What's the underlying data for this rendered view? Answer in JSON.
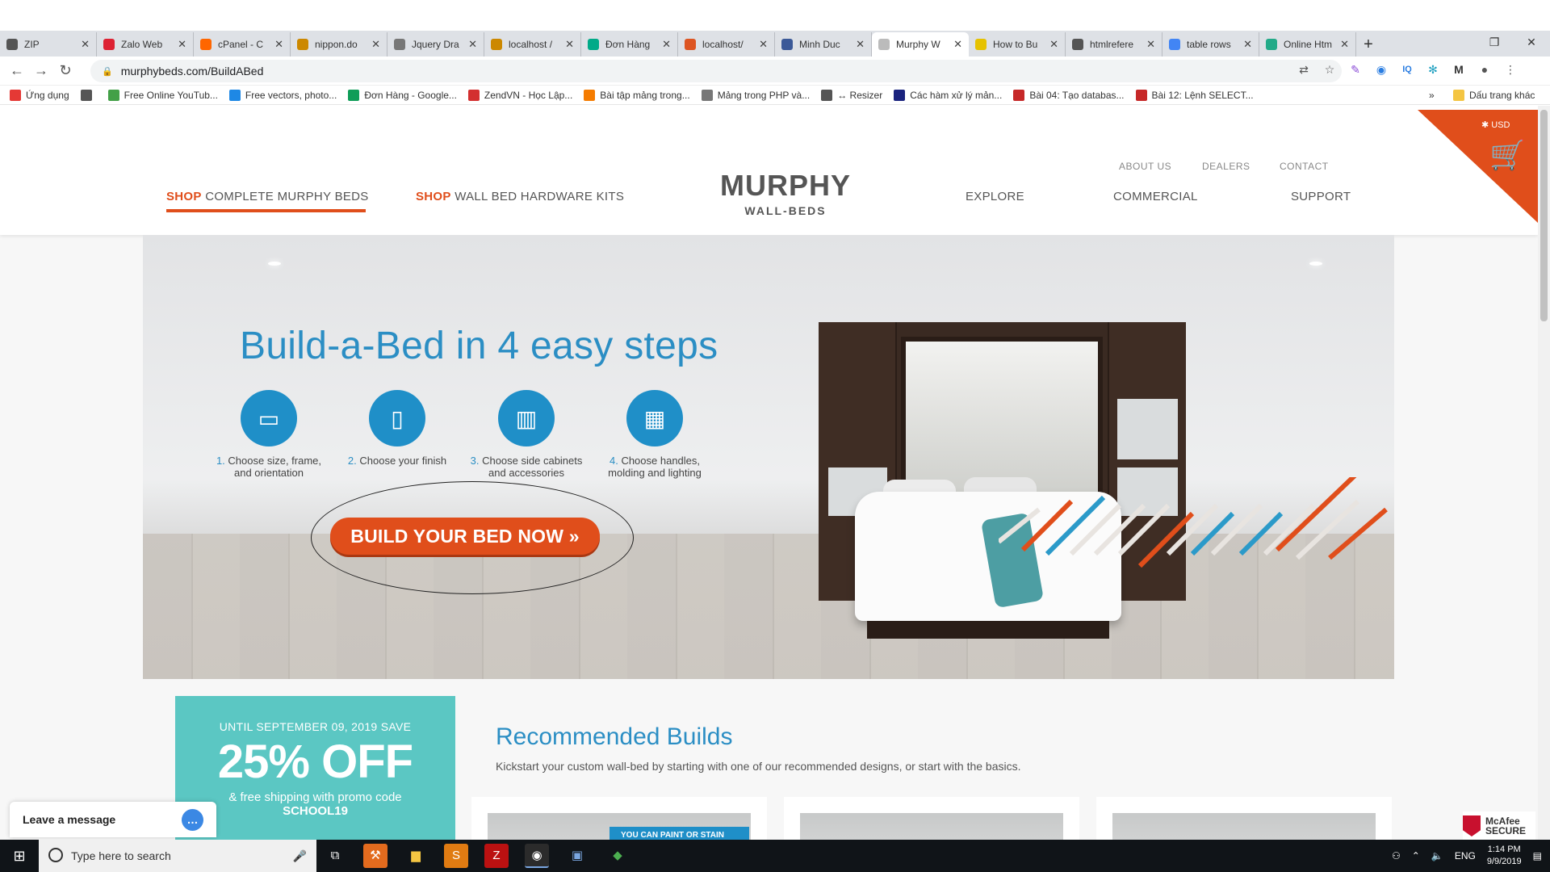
{
  "browser": {
    "tabs": [
      {
        "title": "ZIP",
        "color": "#555"
      },
      {
        "title": "Zalo Web",
        "color": "#d23"
      },
      {
        "title": "cPanel - C",
        "color": "#f60"
      },
      {
        "title": "nippon.do",
        "color": "#c80"
      },
      {
        "title": "Jquery Dra",
        "color": "#777"
      },
      {
        "title": "localhost /",
        "color": "#c80"
      },
      {
        "title": "Đơn Hàng",
        "color": "#0a8"
      },
      {
        "title": "localhost/",
        "color": "#d52"
      },
      {
        "title": "Minh Duc",
        "color": "#3b5998"
      },
      {
        "title": "Murphy W",
        "color": "#bbb"
      },
      {
        "title": "How to Bu",
        "color": "#e6c200"
      },
      {
        "title": "htmlrefere",
        "color": "#555"
      },
      {
        "title": "table rows",
        "color": "#4285f4"
      },
      {
        "title": "Online Htm",
        "color": "#2a8"
      }
    ],
    "url": "murphybeds.com/BuildABed",
    "bookmarks": [
      {
        "label": "Ứng dụng"
      },
      {
        "label": ""
      },
      {
        "label": "Free Online YouTub..."
      },
      {
        "label": "Free vectors, photo..."
      },
      {
        "label": "Đơn Hàng - Google..."
      },
      {
        "label": "ZendVN - Học Lập..."
      },
      {
        "label": "Bài tập mảng trong..."
      },
      {
        "label": "Mảng trong PHP và..."
      },
      {
        "label": "↔ Resizer"
      },
      {
        "label": "Các hàm xử lý mản..."
      },
      {
        "label": "Bài 04: Tạo databas..."
      },
      {
        "label": "Bài 12: Lệnh SELECT..."
      }
    ],
    "bookmarks_more": "»",
    "other_bookmarks": "Dấu trang khác"
  },
  "site": {
    "top_nav": [
      "ABOUT US",
      "DEALERS",
      "CONTACT"
    ],
    "nav_shop1_prefix": "SHOP",
    "nav_shop1": "COMPLETE MURPHY BEDS",
    "nav_shop2_prefix": "SHOP",
    "nav_shop2": "WALL BED HARDWARE KITS",
    "logo_main": "MURPHY",
    "logo_sub": "WALL-BEDS",
    "nav_right": [
      "EXPLORE",
      "COMMERCIAL",
      "SUPPORT"
    ],
    "currency": "USD",
    "hero": {
      "title": "Build-a-Bed in 4 easy steps",
      "steps": [
        {
          "num": "1.",
          "text": "Choose size, frame,",
          "text2": "and orientation"
        },
        {
          "num": "2.",
          "text": "Choose your finish",
          "text2": ""
        },
        {
          "num": "3.",
          "text": "Choose side cabinets",
          "text2": "and accessories"
        },
        {
          "num": "4.",
          "text": "Choose handles,",
          "text2": "molding and lighting"
        }
      ],
      "cta": "BUILD YOUR BED NOW »"
    },
    "promo": {
      "line1": "UNTIL SEPTEMBER 09, 2019 SAVE",
      "big": "25% OFF",
      "line3": "& free shipping with promo code",
      "code": "SCHOOL19"
    },
    "recommended": {
      "title": "Recommended Builds",
      "subtitle": "Kickstart your custom wall-bed by starting with one of our recommended designs, or start with the basics.",
      "badge": "YOU CAN PAINT OR STAIN"
    },
    "chat": "Leave a message",
    "mcafee_line1": "McAfee",
    "mcafee_line2": "SECURE"
  },
  "taskbar": {
    "search_placeholder": "Type here to search",
    "lang": "ENG",
    "time": "1:14 PM",
    "date": "9/9/2019"
  }
}
